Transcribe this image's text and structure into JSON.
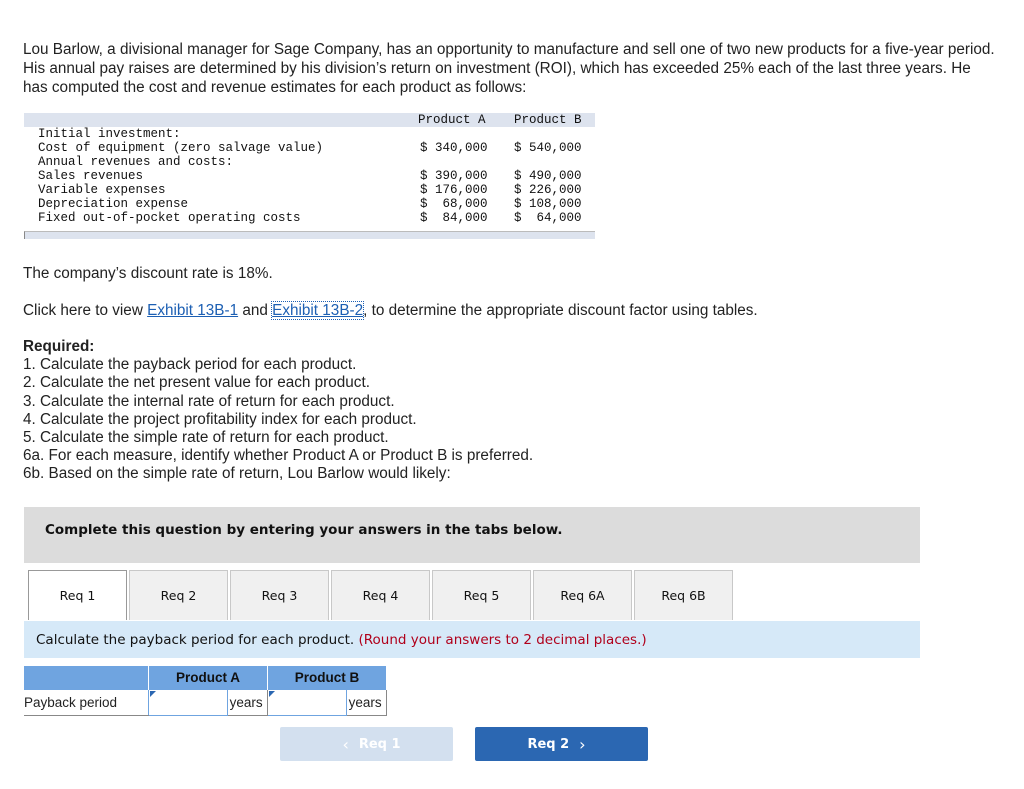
{
  "intro": "Lou Barlow, a divisional manager for Sage Company, has an opportunity to manufacture and sell one of two new products for a five-year period. His annual pay raises are determined by his division’s return on investment (ROI), which has exceeded 25% each of the last three years. He has computed the cost and revenue estimates for each product as follows:",
  "table": {
    "headers": [
      "Product A",
      "Product B"
    ],
    "rows": [
      {
        "label": "Initial investment:",
        "a": "",
        "b": ""
      },
      {
        "label": "Cost of equipment (zero salvage value)",
        "a": "$ 340,000",
        "b": "$ 540,000"
      },
      {
        "label": "Annual revenues and costs:",
        "a": "",
        "b": ""
      },
      {
        "label": "Sales revenues",
        "a": "$ 390,000",
        "b": "$ 490,000"
      },
      {
        "label": "Variable expenses",
        "a": "$ 176,000",
        "b": "$ 226,000"
      },
      {
        "label": "Depreciation expense",
        "a": "$  68,000",
        "b": "$ 108,000"
      },
      {
        "label": "Fixed out-of-pocket operating costs",
        "a": "$  84,000",
        "b": "$  64,000"
      }
    ]
  },
  "discount_text": "The company’s discount rate is 18%.",
  "exhibit": {
    "prefix": "Click here to view ",
    "link1": "Exhibit 13B-1",
    "and": " and ",
    "link2": "Exhibit 13B-2",
    "suffix": ", to determine the appropriate discount factor using tables."
  },
  "required": {
    "title": "Required:",
    "items": [
      "1. Calculate the payback period for each product.",
      "2. Calculate the net present value for each product.",
      "3. Calculate the internal rate of return for each product.",
      "4. Calculate the project profitability index for each product.",
      "5. Calculate the simple rate of return for each product.",
      "6a. For each measure, identify whether Product A or Product B is preferred.",
      "6b. Based on the simple rate of return, Lou Barlow would likely:"
    ]
  },
  "banner": "Complete this question by entering your answers in the tabs below.",
  "tabs": [
    "Req 1",
    "Req 2",
    "Req 3",
    "Req 4",
    "Req 5",
    "Req 6A",
    "Req 6B"
  ],
  "active_tab": "Req 1",
  "instruction": {
    "main": "Calculate the payback period for each product. ",
    "note": "(Round your answers to 2 decimal places.)"
  },
  "answer_table": {
    "headers": [
      "Product A",
      "Product B"
    ],
    "row_label": "Payback period",
    "unit": "years",
    "value_a": "",
    "value_b": ""
  },
  "nav": {
    "prev_label": "Req 1",
    "next_label": "Req 2"
  }
}
